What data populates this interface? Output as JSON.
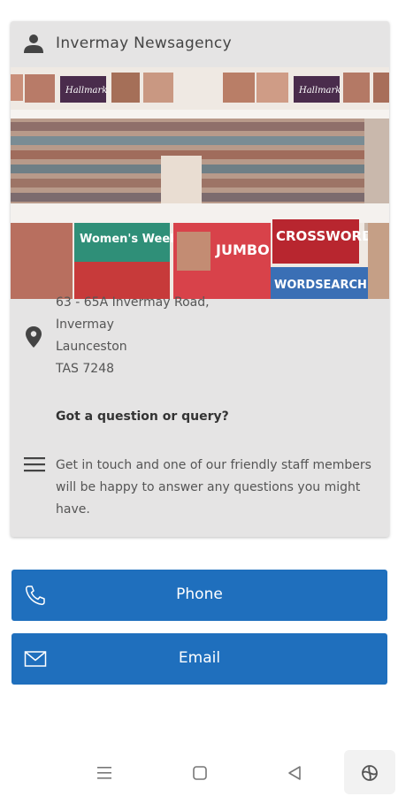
{
  "card": {
    "title": "Invermay Newsagency",
    "photo": {
      "magazines": [
        "Women's Weekly",
        "JUMBO",
        "CROSSWORDS",
        "WORDSEARCHES",
        "Hallmark"
      ]
    },
    "address": [
      "63 - 65A Invermay Road,",
      "Invermay",
      "Launceston",
      "TAS 7248"
    ],
    "question": "Got a question or query?",
    "description": "Get in touch and one of our friendly staff members will be happy to answer any questions you might have."
  },
  "actions": {
    "phone_label": "Phone",
    "email_label": "Email"
  },
  "colors": {
    "card_bg": "#e5e4e4",
    "button_bg": "#1f6fbd",
    "button_text": "#ffffff"
  },
  "icons": [
    "person-icon",
    "map-pin-icon",
    "menu-icon",
    "phone-icon",
    "mail-icon",
    "nav-recents-icon",
    "nav-home-icon",
    "nav-back-icon",
    "nav-extra-icon"
  ]
}
